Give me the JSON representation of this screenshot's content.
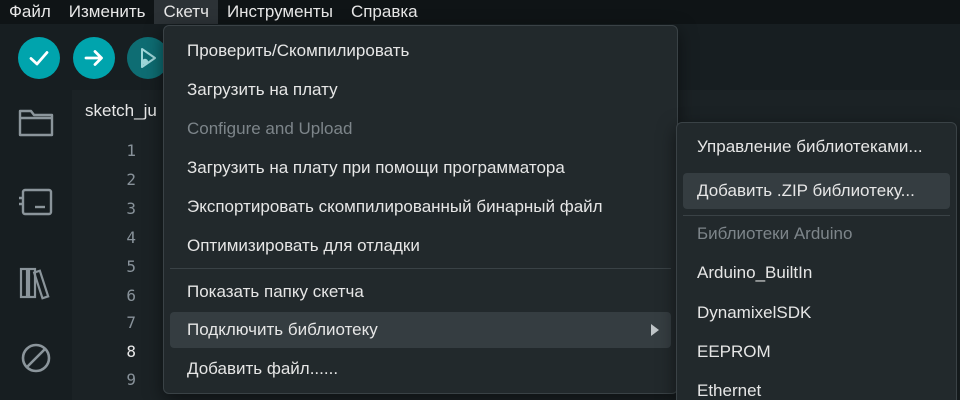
{
  "menubar": {
    "items": [
      {
        "label": "Файл"
      },
      {
        "label": "Изменить"
      },
      {
        "label": "Скетч"
      },
      {
        "label": "Инструменты"
      },
      {
        "label": "Справка"
      }
    ]
  },
  "toolbar": {
    "verify_icon": "check-icon",
    "upload_icon": "arrow-right-icon",
    "debug_icon": "debug-icon"
  },
  "rail": {
    "icons": [
      "folder-icon",
      "board-icon",
      "library-icon",
      "no-entry-icon"
    ]
  },
  "editor": {
    "tab_label": "sketch_ju",
    "line_numbers": [
      "1",
      "2",
      "3",
      "4",
      "5",
      "6",
      "7",
      "8",
      "9"
    ],
    "current_line": "8"
  },
  "sketch_menu": {
    "items": [
      {
        "label": "Проверить/Скомпилировать",
        "enabled": true
      },
      {
        "label": "Загрузить на плату",
        "enabled": true
      },
      {
        "label": "Configure and Upload",
        "enabled": false
      },
      {
        "label": "Загрузить на плату при помощи программатора",
        "enabled": true
      },
      {
        "label": "Экспортировать скомпилированный бинарный файл",
        "enabled": true
      },
      {
        "label": "Оптимизировать для отладки",
        "enabled": true
      },
      {
        "label": "Показать папку скетча",
        "enabled": true
      },
      {
        "label": "Подключить библиотеку",
        "enabled": true,
        "submenu": true
      },
      {
        "label": "Добавить файл......",
        "enabled": true
      }
    ]
  },
  "library_menu": {
    "items": [
      {
        "label": "Управление библиотеками...",
        "enabled": true
      },
      {
        "label": "Добавить .ZIP библиотеку...",
        "enabled": true
      },
      {
        "label": "Библиотеки Arduino",
        "enabled": false
      },
      {
        "label": "Arduino_BuiltIn",
        "enabled": true
      },
      {
        "label": "DynamixelSDK",
        "enabled": true
      },
      {
        "label": "EEPROM",
        "enabled": true
      },
      {
        "label": "Ethernet",
        "enabled": true
      }
    ]
  },
  "colors": {
    "accent": "#00a4ad",
    "background": "#171e21",
    "menu_bg": "#22292c"
  }
}
